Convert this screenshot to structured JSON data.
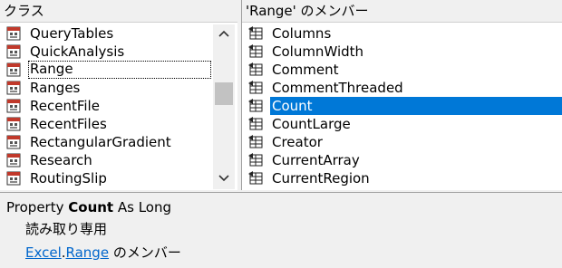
{
  "classes_pane": {
    "header": "クラス",
    "items": [
      {
        "label": "QueryTables"
      },
      {
        "label": "QuickAnalysis"
      },
      {
        "label": "Range"
      },
      {
        "label": "Ranges"
      },
      {
        "label": "RecentFile"
      },
      {
        "label": "RecentFiles"
      },
      {
        "label": "RectangularGradient"
      },
      {
        "label": "Research"
      },
      {
        "label": "RoutingSlip"
      }
    ],
    "focused_item": "Range"
  },
  "members_pane": {
    "header": "'Range' のメンバー",
    "items": [
      {
        "label": "Columns"
      },
      {
        "label": "ColumnWidth"
      },
      {
        "label": "Comment"
      },
      {
        "label": "CommentThreaded"
      },
      {
        "label": "Count"
      },
      {
        "label": "CountLarge"
      },
      {
        "label": "Creator"
      },
      {
        "label": "CurrentArray"
      },
      {
        "label": "CurrentRegion"
      }
    ],
    "selected_item": "Count"
  },
  "details": {
    "prefix": "Property ",
    "name": "Count",
    "suffix": " As Long",
    "readonly": "読み取り専用",
    "library_link": "Excel",
    "separator": ".",
    "class_link": "Range",
    "member_of": " のメンバー"
  },
  "icons": {
    "class_icon": "class-module-icon",
    "property_icon": "property-icon"
  },
  "colors": {
    "selection": "#0078d7",
    "link": "#0066cc"
  }
}
